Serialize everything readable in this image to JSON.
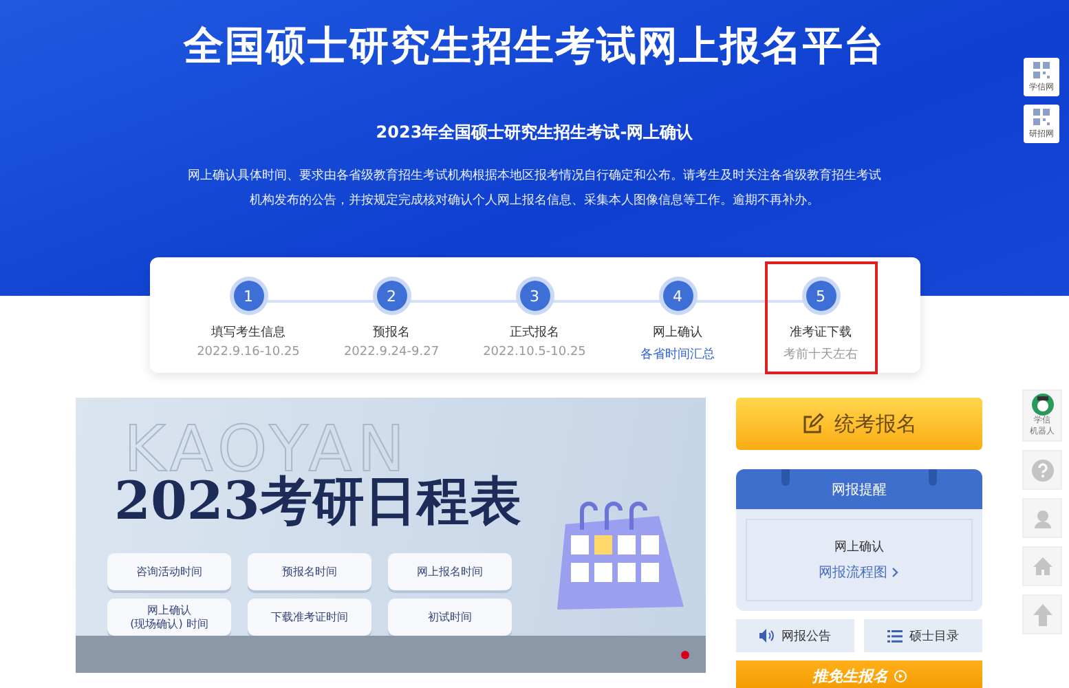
{
  "header": {
    "title": "全国硕士研究生招生考试网上报名平台",
    "subtitle": "2023年全国硕士研究生招生考试-网上确认",
    "notice": "网上确认具体时间、要求由各省级教育招生考试机构根据本地区报考情况自行确定和公布。请考生及时关注各省级教育招生考试机构发布的公告，并按规定完成核对确认个人网上报名信息、采集本人图像信息等工作。逾期不再补办。"
  },
  "side_links": [
    {
      "label": "学信网"
    },
    {
      "label": "研招网"
    }
  ],
  "steps": [
    {
      "number": "1",
      "label": "填写考生信息",
      "date": "2022.9.16-10.25",
      "kind": "date",
      "highlighted": false
    },
    {
      "number": "2",
      "label": "预报名",
      "date": "2022.9.24-9.27",
      "kind": "date",
      "highlighted": false
    },
    {
      "number": "3",
      "label": "正式报名",
      "date": "2022.10.5-10.25",
      "kind": "date",
      "highlighted": false
    },
    {
      "number": "4",
      "label": "网上确认",
      "date": "各省时间汇总",
      "kind": "link",
      "highlighted": false
    },
    {
      "number": "5",
      "label": "准考证下载",
      "date": "考前十天左右",
      "kind": "date",
      "highlighted": true
    }
  ],
  "schedule_banner": {
    "watermark": "KAOYAN",
    "title": "2023考研日程表",
    "buttons": [
      {
        "lines": [
          "咨询活动时间"
        ]
      },
      {
        "lines": [
          "预报名时间"
        ]
      },
      {
        "lines": [
          "网上报名时间"
        ]
      },
      {
        "lines": [
          "网上确认",
          "(现场确认) 时间"
        ]
      },
      {
        "lines": [
          "下载准考证时间"
        ]
      },
      {
        "lines": [
          "初试时间"
        ]
      }
    ],
    "dots": [
      {
        "selected": true
      }
    ]
  },
  "register_button": "统考报名",
  "reminder": {
    "title": "网报提醒",
    "item": "网上确认",
    "link": "网报流程图"
  },
  "quick_links": [
    {
      "label": "网报公告",
      "kind": "announce"
    },
    {
      "label": "硕士目录",
      "kind": "list"
    }
  ],
  "exempt_button": "推免生报名",
  "float_tools": [
    {
      "kind": "robot",
      "lines": [
        "学信",
        "机器人"
      ]
    },
    {
      "kind": "help"
    },
    {
      "kind": "service"
    },
    {
      "kind": "home"
    },
    {
      "kind": "top"
    }
  ]
}
